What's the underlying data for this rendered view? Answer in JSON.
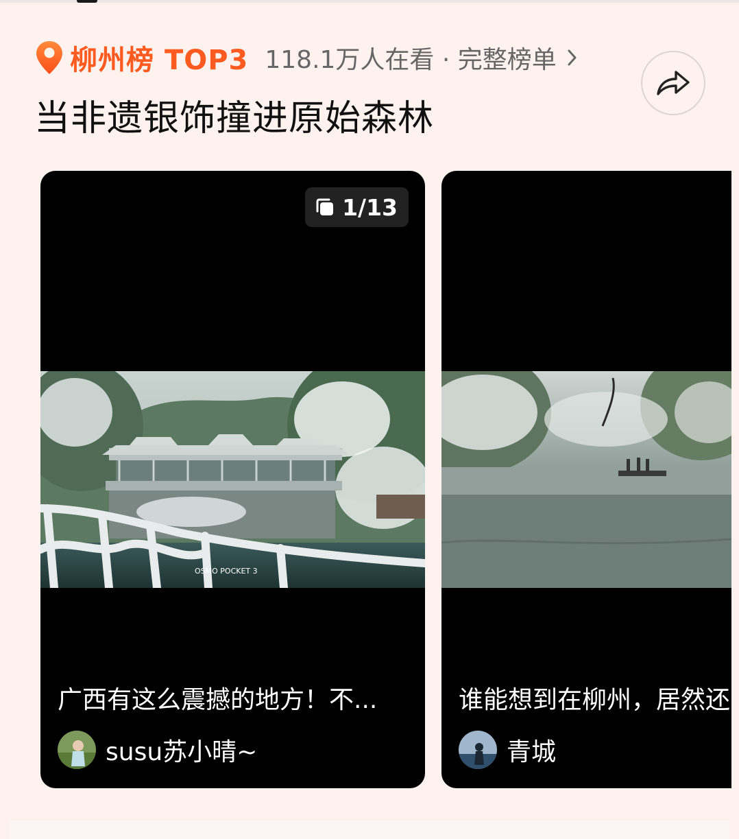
{
  "header": {
    "rank_title": "柳州榜",
    "rank_tag": "TOP3",
    "viewers_text": "118.1万人在看 · 完整榜单",
    "accent_color": "#ff5a1f"
  },
  "headline": "当非遗银饰撞进原始森林",
  "share_icon": "share-arrow-icon",
  "cards": [
    {
      "page_badge": "1/13",
      "watermark": "OSMO POCKET 3",
      "caption": "广西有这么震撼的地方！不...",
      "author": "susu苏小晴~"
    },
    {
      "caption": "谁能想到在柳州，居然还",
      "author": "青城"
    }
  ]
}
